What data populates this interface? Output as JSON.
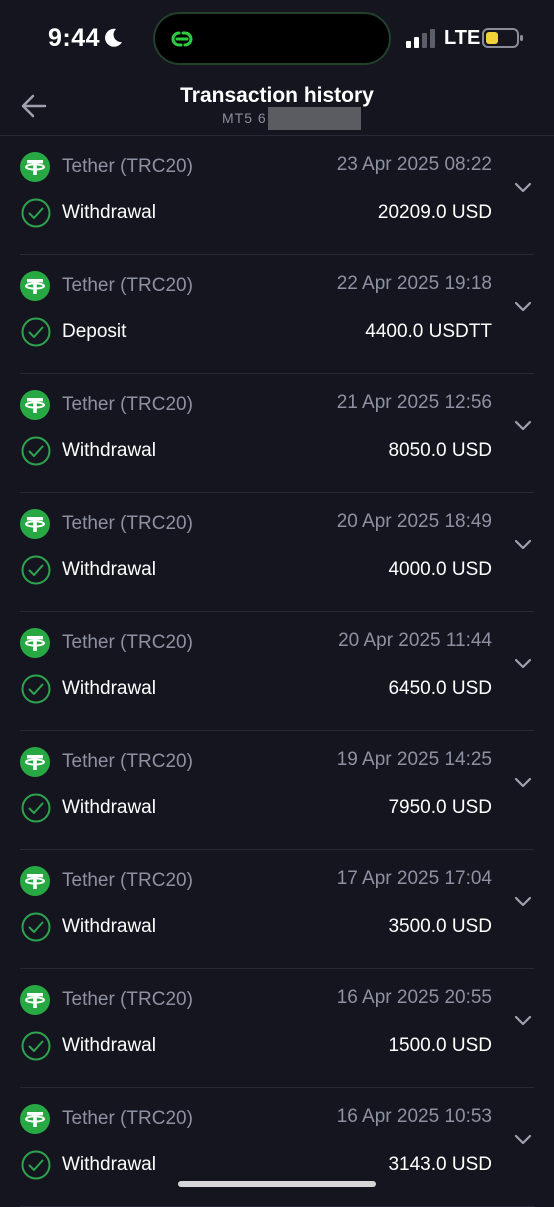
{
  "status_bar": {
    "time": "9:44",
    "network": "LTE",
    "colors": {
      "island_accent": "#2ecc40",
      "battery": "#f2d43a"
    }
  },
  "header": {
    "title": "Transaction history",
    "subtitle": "MT5 6"
  },
  "colors": {
    "accent_green": "#2ea44f",
    "tether_green": "#27a843",
    "background": "#14151f",
    "muted_text": "#8e91a1"
  },
  "transactions": [
    {
      "coin": "Tether (TRC20)",
      "date": "23 Apr 2025 08:22",
      "type": "Withdrawal",
      "amount": "20209.0 USD"
    },
    {
      "coin": "Tether (TRC20)",
      "date": "22 Apr 2025 19:18",
      "type": "Deposit",
      "amount": "4400.0 USDTT"
    },
    {
      "coin": "Tether (TRC20)",
      "date": "21 Apr 2025 12:56",
      "type": "Withdrawal",
      "amount": "8050.0 USD"
    },
    {
      "coin": "Tether (TRC20)",
      "date": "20 Apr 2025 18:49",
      "type": "Withdrawal",
      "amount": "4000.0 USD"
    },
    {
      "coin": "Tether (TRC20)",
      "date": "20 Apr 2025 11:44",
      "type": "Withdrawal",
      "amount": "6450.0 USD"
    },
    {
      "coin": "Tether (TRC20)",
      "date": "19 Apr 2025 14:25",
      "type": "Withdrawal",
      "amount": "7950.0 USD"
    },
    {
      "coin": "Tether (TRC20)",
      "date": "17 Apr 2025 17:04",
      "type": "Withdrawal",
      "amount": "3500.0 USD"
    },
    {
      "coin": "Tether (TRC20)",
      "date": "16 Apr 2025 20:55",
      "type": "Withdrawal",
      "amount": "1500.0 USD"
    },
    {
      "coin": "Tether (TRC20)",
      "date": "16 Apr 2025 10:53",
      "type": "Withdrawal",
      "amount": "3143.0 USD"
    }
  ],
  "icons": {
    "coin": "tether-icon",
    "status": "check-circle-icon",
    "expand": "chevron-down-icon",
    "back": "arrow-left-icon"
  }
}
